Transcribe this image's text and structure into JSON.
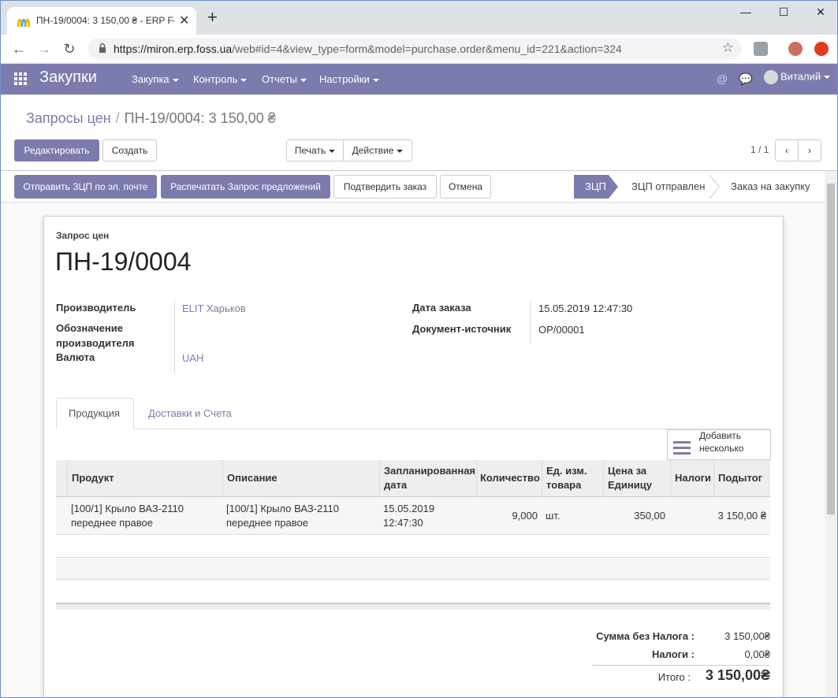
{
  "browser": {
    "tab_title": "ПН-19/0004: 3 150,00 ₴ - ERP Foss",
    "url_host": "https://miron.erp.foss.ua",
    "url_path": "/web#id=4&view_type=form&model=purchase.order&menu_id=221&action=324"
  },
  "navbar": {
    "app_name": "Закупки",
    "menus": [
      "Закупка",
      "Контроль",
      "Отчеты",
      "Настройки"
    ],
    "user": "Виталий"
  },
  "breadcrumb": {
    "parent": "Запросы цен",
    "current": "ПН-19/0004: 3 150,00 ₴"
  },
  "buttons": {
    "edit": "Редактировать",
    "create": "Создать",
    "print": "Печать",
    "action": "Действие",
    "pager": "1 / 1",
    "send_email": "Отправить ЗЦП по эл. почте",
    "print_rfq": "Распечатать Запрос предложений",
    "confirm": "Подтвердить заказ",
    "cancel": "Отмена"
  },
  "statusbar": {
    "stages": [
      "ЗЦП",
      "ЗЦП отправлен",
      "Заказ на закупку"
    ],
    "active": "ЗЦП"
  },
  "form": {
    "doc_type": "Запрос цен",
    "name": "ПН-19/0004",
    "vendor_label": "Производитель",
    "vendor": "ELIT Харьков",
    "vendor_ref_label_1": "Обозначение",
    "vendor_ref_label_2": "производителя",
    "currency_label": "Валюта",
    "currency": "UAH",
    "date_order_label": "Дата заказа",
    "date_order": "15.05.2019 12:47:30",
    "origin_label": "Документ-источник",
    "origin": "OP/00001"
  },
  "tabs": [
    "Продукция",
    "Доставки и Счета"
  ],
  "add_multiple": {
    "line1": "Добавить",
    "line2": "несколько"
  },
  "table": {
    "headers": {
      "product": "Продукт",
      "description": "Описание",
      "date1": "Запланированная",
      "date2": "дата",
      "qty": "Количество",
      "uom1": "Ед. изм.",
      "uom2": "товара",
      "price1": "Цена за",
      "price2": "Единицу",
      "taxes": "Налоги",
      "subtotal": "Подытог"
    },
    "rows": [
      {
        "product1": "[100/1] Крыло ВАЗ-2110",
        "product2": "переднее правое",
        "desc1": "[100/1] Крыло ВАЗ-2110",
        "desc2": "переднее правое",
        "date1": "15.05.2019",
        "date2": "12:47:30",
        "qty": "9,000",
        "uom": "шт.",
        "price": "350,00",
        "subtotal": "3 150,00 ₴"
      }
    ]
  },
  "totals": {
    "untaxed_label": "Сумма без Налога :",
    "untaxed": "3 150,00₴",
    "taxes_label": "Налоги :",
    "taxes": "0,00₴",
    "total_label": "Итого :",
    "total": "3 150,00₴"
  },
  "colors": {
    "brand": "#7c7bad"
  }
}
